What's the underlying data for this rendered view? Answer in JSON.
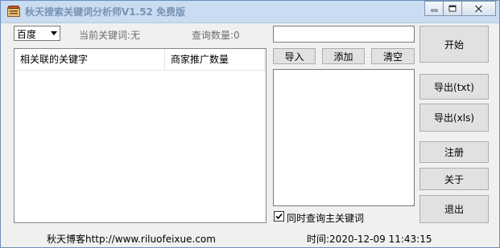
{
  "window": {
    "title": "秋天搜索关键词分析师V1.52 免费版"
  },
  "search_engine": {
    "selected": "百度"
  },
  "status": {
    "current_keyword": "当前关键词:无",
    "query_count": "查询数量:0"
  },
  "result_table": {
    "columns": [
      "相关联的关键字",
      "商家推广数量"
    ]
  },
  "keyword_input": {
    "value": ""
  },
  "keyword_buttons": {
    "import": "导入",
    "add": "添加",
    "clear": "清空"
  },
  "also_query_main": {
    "label": "同时查询主关键词",
    "checked": true
  },
  "actions": {
    "start": "开始",
    "export_txt": "导出(txt)",
    "export_xls": "导出(xls)",
    "register": "注册",
    "about": "关于",
    "exit": "退出"
  },
  "footer": {
    "blog": "秋天博客http://www.riluofeixue.com",
    "time": "时间:2020-12-09 11:43:15"
  },
  "colors": {
    "titlebar": "#c9dcf1",
    "title_text": "#7a93b3",
    "button_face": "#e1e1e1"
  }
}
